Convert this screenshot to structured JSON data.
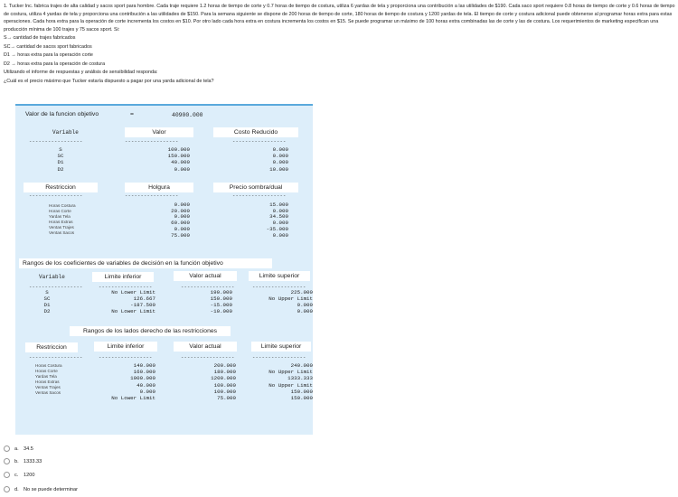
{
  "problem": {
    "text": "1.    Tucker Inc. fabrica trajes de alta calidad y sacos sport para hombre. Cada traje requiere 1.2 horas de tiempo de corte y 0.7 horas de tiempo de costura, utiliza 6 yardas de tela y proporciona una contribución a las utilidades de $190. Cada saco sport requiere 0.8 horas de tiempo de corte y 0.6 horas de tiempo de costura, utiliza 4 yardas de tela y proporciona una contribución a las utilidades de $150. Para la semana siguiente se dispone de 200 horas de tiempo de corte, 180 horas de tiempo de costura y 1200 yardas de tela. El tiempo de corte y costura adicional puede obtenerse al programar horas extra para estas operaciones. Cada hora extra para la operación de corte incrementa los costos en $10. Por otro lado cada hora extra en costura incrementa los costos en $15. Se puede programar un máximo de 100 horas extra combinadas las de corte y las de costura. Los requerimientos de marketing especifican una producción mínima de 100 trajes y 75 sacos sport. Si:"
  },
  "definitions": [
    "S→ cantidad de trajes fabricados",
    "SC→  cantidad de sacos sport fabricados",
    "D1 → horas extra para la operación corte",
    "D2 → horas extra para la operación de costura",
    "Utilizando el informe de respuestas y análisis de sensibilidad responda:",
    "¿Cuál es el precio máximo que Tucker estaría dispuesto a pagar por una yarda adicional de tela?"
  ],
  "report": {
    "objective_label": "Valor de la funcion objetivo",
    "objective_eq": "=",
    "objective_value": "40900.000",
    "var_section": {
      "headers": [
        "Variable",
        "Valor",
        "Costo Reducido"
      ],
      "rows": [
        {
          "name": "S",
          "value": "100.000",
          "reduced": "0.000"
        },
        {
          "name": "SC",
          "value": "150.000",
          "reduced": "0.000"
        },
        {
          "name": "D1",
          "value": "40.000",
          "reduced": "0.000"
        },
        {
          "name": "D2",
          "value": "0.000",
          "reduced": "10.000"
        }
      ]
    },
    "con_section": {
      "headers": [
        "Restriccion",
        "Holgura",
        "Precio sombra/dual"
      ],
      "rows": [
        {
          "name": "Horas Costura",
          "slack": "0.000",
          "dual": "15.000"
        },
        {
          "name": "Horas Corte",
          "slack": "20.000",
          "dual": "0.000"
        },
        {
          "name": "Yardas Tela",
          "slack": "0.000",
          "dual": "34.500"
        },
        {
          "name": "Horas Extras",
          "slack": "60.000",
          "dual": "0.000"
        },
        {
          "name": "Ventas Trajes",
          "slack": "0.000",
          "dual": "-35.000"
        },
        {
          "name": "Ventas Sacos",
          "slack": "75.000",
          "dual": "0.000"
        }
      ]
    },
    "obj_ranges": {
      "title": "Rangos de los coeficientes de variables de decisión en la función objetivo",
      "headers": [
        "Variable",
        "Limite inferior",
        "Valor actual",
        "Limite superior"
      ],
      "rows": [
        {
          "name": "S",
          "lower": "No Lower Limit",
          "current": "190.000",
          "upper": "225.000"
        },
        {
          "name": "SC",
          "lower": "126.667",
          "current": "150.000",
          "upper": "No Upper Limit"
        },
        {
          "name": "D1",
          "lower": "-187.500",
          "current": "-15.000",
          "upper": "0.000"
        },
        {
          "name": "D2",
          "lower": "No Lower Limit",
          "current": "-10.000",
          "upper": "0.000"
        }
      ]
    },
    "rhs_ranges": {
      "title": "Rangos de los lados derecho de las restricciones",
      "headers": [
        "Restriccion",
        "Limite inferior",
        "Valor actual",
        "Limite superior"
      ],
      "rows": [
        {
          "name": "Horas Costura",
          "lower": "140.000",
          "current": "200.000",
          "upper": "240.000"
        },
        {
          "name": "Horas Corte",
          "lower": "160.000",
          "current": "180.000",
          "upper": "No Upper Limit"
        },
        {
          "name": "Yardas Tela",
          "lower": "1000.000",
          "current": "1200.000",
          "upper": "1333.333"
        },
        {
          "name": "Horas Extras",
          "lower": "40.000",
          "current": "100.000",
          "upper": "No Upper Limit"
        },
        {
          "name": "Ventas Trajes",
          "lower": "0.000",
          "current": "100.000",
          "upper": "150.000"
        },
        {
          "name": "Ventas Sacos",
          "lower": "No Lower Limit",
          "current": "75.000",
          "upper": "150.000"
        }
      ]
    },
    "dashes": "-----------------"
  },
  "options": [
    {
      "letter": "a.",
      "text": "34.5"
    },
    {
      "letter": "b.",
      "text": "1333.33"
    },
    {
      "letter": "c.",
      "text": "1200"
    },
    {
      "letter": "d.",
      "text": "No se puede determinar"
    }
  ]
}
